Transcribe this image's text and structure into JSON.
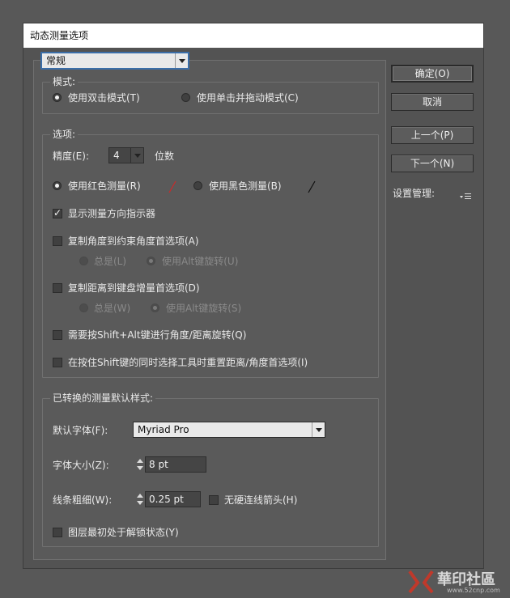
{
  "window": {
    "title": "动态测量选项"
  },
  "page_select": {
    "value": "常规"
  },
  "buttons": {
    "ok": "确定(O)",
    "cancel": "取消",
    "prev": "上一个(P)",
    "next": "下一个(N)",
    "settings_label": "设置管理:",
    "settings_icon": "settings-menu-icon"
  },
  "mode": {
    "legend": "模式:",
    "option1": "使用双击模式(T)",
    "option2": "使用单击并拖动模式(C)",
    "selected": 1
  },
  "options": {
    "legend": "选项:",
    "precision_label": "精度(E):",
    "precision_value": "4",
    "precision_unit": "位数",
    "red_label": "使用红色测量(R)",
    "black_label": "使用黑色测量(B)",
    "color_red": "#cc2a2a",
    "color_black": "#111111",
    "show_direction": "显示测量方向指示器",
    "show_direction_checked": true,
    "copy_angle": "复制角度到约束角度首选项(A)",
    "copy_angle_always": "总是(L)",
    "copy_angle_alt": "使用Alt键旋转(U)",
    "copy_distance": "复制距离到键盘增量首选项(D)",
    "copy_distance_always": "总是(W)",
    "copy_distance_alt": "使用Alt键旋转(S)",
    "shift_alt": "需要按Shift+Alt键进行角度/距离旋转(Q)",
    "shift_select": "在按住Shift键的同时选择工具时重置距离/角度首选项(I)"
  },
  "style": {
    "legend": "已转换的测量默认样式:",
    "font_label": "默认字体(F):",
    "font_value": "Myriad Pro",
    "size_label": "字体大小(Z):",
    "size_value": "8 pt",
    "stroke_label": "线条粗细(W):",
    "stroke_value": "0.25 pt",
    "no_hard_arrow": "无硬连线箭头(H)",
    "unlock_layer": "图层最初处于解锁状态(Y)"
  },
  "watermark": {
    "brand": "華印社區",
    "url": "www.52cnp.com"
  }
}
